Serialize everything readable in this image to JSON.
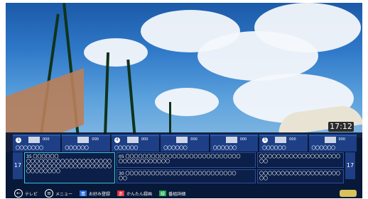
{
  "clock": "17:12",
  "time_left": "17",
  "time_right": "17",
  "channels": [
    {
      "num": "1",
      "code": "000",
      "name": "〇〇〇〇〇〇〇"
    },
    {
      "num": "",
      "code": "000",
      "name": "〇〇〇〇〇〇"
    },
    {
      "num": "4",
      "code": "000",
      "name": "〇〇〇〇〇〇"
    },
    {
      "num": "",
      "code": "000",
      "name": "〇〇〇〇〇〇"
    },
    {
      "num": "",
      "code": "000",
      "name": "〇〇〇〇〇〇"
    },
    {
      "num": "5",
      "code": "000",
      "name": "〇〇〇〇〇〇"
    },
    {
      "num": "",
      "code": "000",
      "name": "〇〇〇〇〇〇"
    }
  ],
  "programs": [
    {
      "title": "35 〇〇〇〇〇〇",
      "desc": "〇〇〇〇〇〇〇〇〇〇〇〇〇〇〇〇〇〇〇〇〇〇〇〇〇〇〇〇〇〇〇〇〇〇〇〇〇〇〇〇〇〇〇〇〇〇〇〇"
    },
    {
      "title": "05 〇〇〇〇〇〇〇〇〇〇〇〇〇〇〇〇〇〇〇〇〇〇〇〇〇〇〇",
      "desc": "〇〇〇〇〇〇〇〇〇〇〇〇"
    },
    {
      "title": "30 〇〇〇〇〇〇〇〇〇〇〇〇〇〇〇〇〇〇〇〇〇〇〇〇〇〇",
      "desc": "〇〇"
    },
    {
      "title": "〇〇〇〇〇〇〇〇〇〇〇〇〇〇〇〇〇〇〇",
      "desc": "〇〇"
    },
    {
      "title": "〇〇〇〇〇〇〇〇〇〇〇〇〇〇〇〇〇〇〇",
      "desc": "〇〇"
    }
  ],
  "footer": {
    "back_label": "テレビ",
    "menu_label": "メニュー",
    "blue_label": "お好み登録",
    "red_label": "かんたん録画",
    "green_label": "番組詳細"
  },
  "colors": {
    "blue": "#2b6fe0",
    "red": "#e0333b",
    "green": "#1ea84a"
  }
}
